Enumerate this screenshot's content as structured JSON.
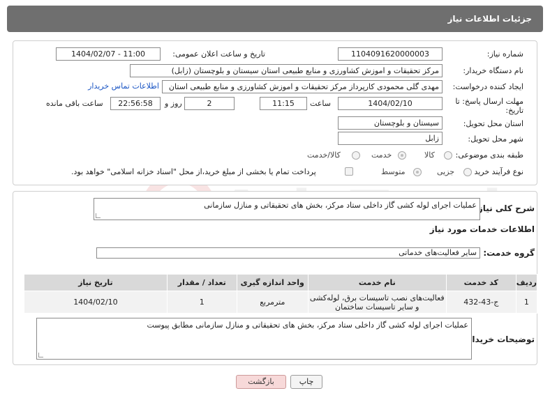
{
  "header": {
    "title": "جزئیات اطلاعات نیاز"
  },
  "form": {
    "need_number_label": "شماره نیاز:",
    "need_number": "1104091620000003",
    "announce_label": "تاریخ و ساعت اعلان عمومی:",
    "announce_value": "1404/02/07 - 11:00",
    "buyer_label": "نام دستگاه خریدار:",
    "buyer_value": "مرکز تحقیقات و اموزش کشاورزی و منابع طبیعی استان سیستان و بلوچستان (زابل)",
    "requester_label": "ایجاد کننده درخواست:",
    "requester_value": "مهدی  گلی محمودی کارپرداز مرکز تحقیقات و اموزش کشاورزی و منابع طبیعی استان",
    "contact_link": "اطلاعات تماس خریدار",
    "deadline_label_1": "مهلت ارسال پاسخ: تا",
    "deadline_label_2": "تاریخ:",
    "deadline_date": "1404/02/10",
    "time_label": "ساعت",
    "deadline_time": "11:15",
    "days_value": "2",
    "days_label": "روز و",
    "remaining_time": "22:56:58",
    "remaining_label": "ساعت باقی مانده",
    "province_label": "استان محل تحویل:",
    "province_value": "سیستان و بلوچستان",
    "city_label": "شهر محل تحویل:",
    "city_value": "زابل",
    "category_label": "طبقه بندی موضوعی:",
    "category_options": [
      "کالا",
      "خدمت",
      "کالا/خدمت"
    ],
    "process_label": "نوع فرآیند خرید :",
    "process_options": [
      "جزیی",
      "متوسط"
    ],
    "payment_note": "پرداخت تمام یا بخشی از مبلغ خرید،از محل \"اسناد خزانه اسلامی\" خواهد بود."
  },
  "details": {
    "description_label": "شرح کلی نیاز:",
    "description_value": "عملیات اجرای لوله کشی گاز داخلی ستاد مرکز، بخش های تحقیقاتی و منازل سازمانی",
    "services_title": "اطلاعات خدمات مورد نیاز",
    "service_group_label": "گروه خدمت:",
    "service_group_value": "سایر فعالیت‌های خدماتی",
    "table_headers": [
      "ردیف",
      "کد خدمت",
      "نام خدمت",
      "واحد اندازه گیری",
      "تعداد / مقدار",
      "تاریخ نیاز"
    ],
    "table_rows": [
      {
        "row": "1",
        "code": "ج-43-432",
        "name": "فعالیت‌های نصب تاسیسات برق، لوله‌کشی و سایر تاسیسات ساختمان",
        "unit": "مترمربع",
        "qty": "1",
        "date": "1404/02/10"
      }
    ],
    "buyer_notes_label": "توضیحات خریدار:",
    "buyer_notes_value": "عملیات اجرای لوله کشی گاز داخلی ستاد مرکز، بخش های تحقیقاتی و منازل سازمانی مطابق پیوست"
  },
  "buttons": {
    "print": "چاپ",
    "back": "بازگشت"
  },
  "watermark": {
    "text": "AriaTender.neT"
  },
  "colors": {
    "header": "#6f6f6f",
    "link": "#1a55c4",
    "back_button": "#f7d9d9"
  }
}
